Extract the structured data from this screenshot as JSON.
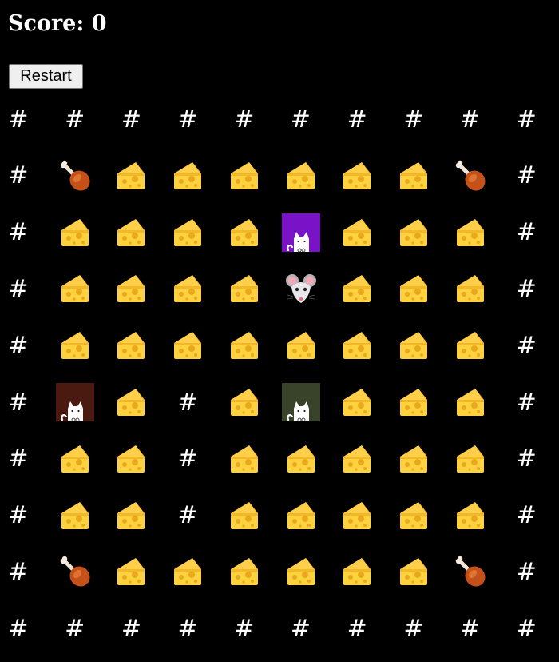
{
  "score": {
    "label": "Score: 0"
  },
  "controls": {
    "restart_label": "Restart"
  },
  "colors": {
    "background": "#000000",
    "wall": "#ffffff",
    "cat_purple": "#7a12c8",
    "cat_brown": "#4a1a10",
    "cat_olive": "#38432a"
  },
  "board": {
    "rows": [
      "##########",
      "#DCCCCCCD#",
      "#CCCCPCCC#",
      "#CCCCMCCC#",
      "#CCCCCCCC#",
      "#BC#COCCC#",
      "#CC#CCCCC#",
      "#CC#CCCCC#",
      "#DCCCCCCD#",
      "##########"
    ],
    "legend": {
      "#": "wall",
      "C": "cheese-icon",
      "D": "drumstick-icon",
      "M": "mouse-icon",
      "P": "cat-purple",
      "B": "cat-brown",
      "O": "cat-olive"
    }
  }
}
